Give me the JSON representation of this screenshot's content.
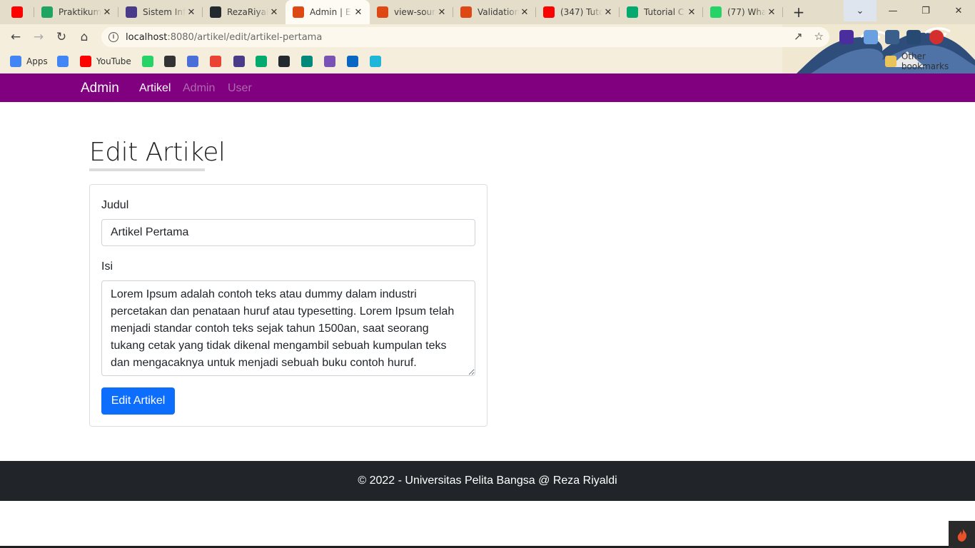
{
  "browser": {
    "tabs": [
      {
        "title": "",
        "icon": "youtube-icon",
        "color": "#ff0000"
      },
      {
        "title": "Praktikum",
        "icon": "google-drive-icon",
        "color": "#1fa463"
      },
      {
        "title": "Sistem Inf",
        "icon": "university-icon",
        "color": "#4a3a8a"
      },
      {
        "title": "RezaRiyal",
        "icon": "github-icon",
        "color": "#24292f"
      },
      {
        "title": "Admin | E",
        "icon": "codeigniter-icon",
        "color": "#dd4814"
      },
      {
        "title": "view-sour",
        "icon": "codeigniter-icon",
        "color": "#dd4814"
      },
      {
        "title": "Validation",
        "icon": "codeigniter-icon",
        "color": "#dd4814"
      },
      {
        "title": "(347) Tuto",
        "icon": "youtube-icon",
        "color": "#ff0000"
      },
      {
        "title": "Tutorial C",
        "icon": "w3schools-icon",
        "color": "#04aa6d"
      },
      {
        "title": "(77) What",
        "icon": "whatsapp-icon",
        "color": "#25d366"
      }
    ],
    "url_host": "localhost",
    "url_rest": ":8080/artikel/edit/artikel-pertama",
    "bookmarks": [
      {
        "label": "Apps",
        "icon": "apps-grid-icon",
        "color": "#4285f4"
      },
      {
        "label": "",
        "icon": "google-translate-icon",
        "color": "#4285f4"
      },
      {
        "label": "YouTube",
        "icon": "youtube-icon",
        "color": "#ff0000"
      },
      {
        "label": "",
        "icon": "whatsapp-icon",
        "color": "#25d366"
      },
      {
        "label": "",
        "icon": "github-square-icon",
        "color": "#333333"
      },
      {
        "label": "",
        "icon": "flag-icon",
        "color": "#4a6fd8"
      },
      {
        "label": "",
        "icon": "gmail-icon",
        "color": "#ea4335"
      },
      {
        "label": "",
        "icon": "university-icon",
        "color": "#4a3a8a"
      },
      {
        "label": "",
        "icon": "w3schools-icon",
        "color": "#04aa6d"
      },
      {
        "label": "",
        "icon": "github-icon",
        "color": "#24292f"
      },
      {
        "label": "",
        "icon": "google-meet-icon",
        "color": "#00897b"
      },
      {
        "label": "",
        "icon": "bootstrap-icon",
        "color": "#7952b3"
      },
      {
        "label": "",
        "icon": "linkedin-icon",
        "color": "#0a66c2"
      },
      {
        "label": "",
        "icon": "search-app-icon",
        "color": "#1fb6d8"
      }
    ],
    "other_bookmarks": "Other bookmarks"
  },
  "nav": {
    "brand": "Admin",
    "links": [
      {
        "label": "Artikel",
        "color": "#ffffff"
      },
      {
        "label": "Admin",
        "color": "#b06ab0"
      },
      {
        "label": "User",
        "color": "#b06ab0"
      }
    ],
    "bg_color": "#800080"
  },
  "page": {
    "title": "Edit Artikel",
    "form": {
      "judul_label": "Judul",
      "judul_value": "Artikel Pertama",
      "isi_label": "Isi",
      "isi_value": "Lorem Ipsum adalah contoh teks atau dummy dalam industri percetakan dan penataan huruf atau typesetting. Lorem Ipsum telah menjadi standar contoh teks sejak tahun 1500an, saat seorang tukang cetak yang tidak dikenal mengambil sebuah kumpulan teks dan mengacaknya untuk menjadi sebuah buku contoh huruf.",
      "submit_label": "Edit Artikel",
      "submit_color": "#0d6efd"
    }
  },
  "footer": {
    "text": "© 2022 - Universitas Pelita Bangsa @ Reza Riyaldi"
  }
}
